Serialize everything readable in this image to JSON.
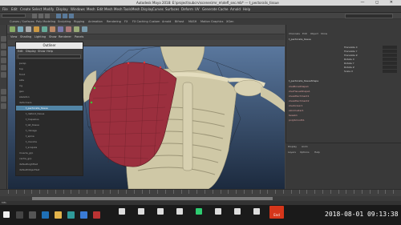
{
  "window": {
    "title": "Autodesk Maya 2018: E:\\project\\subcrv\\scenes\\mr_m\\defl_sec.mb* --- t_pectoralis_tissue",
    "controls": "— ◻ ✕"
  },
  "menubar": {
    "items": [
      "File",
      "Edit",
      "Create",
      "Select",
      "Modify",
      "Display",
      "Windows",
      "Mesh",
      "Edit Mesh",
      "Mesh Tools",
      "Mesh Display",
      "Curves",
      "Surfaces",
      "Deform",
      "UV",
      "Generate",
      "Cache",
      "Arnold",
      "Help"
    ]
  },
  "shelf": {
    "tabs": [
      "Curves / Surfaces",
      "Poly Modeling",
      "Sculpting",
      "Rigging",
      "Animation",
      "Rendering",
      "FX",
      "FX Caching",
      "Custom",
      "Arnold",
      "Bifrost",
      "MASH",
      "Motion Graphics",
      "XGen"
    ]
  },
  "viewport": {
    "menu": [
      "View",
      "Shading",
      "Lighting",
      "Show",
      "Renderer",
      "Panels"
    ]
  },
  "outliner": {
    "title": "Outliner",
    "menu": [
      "Edit",
      "Display",
      "Show",
      "Help"
    ],
    "rows": [
      {
        "label": "persp",
        "selected": false
      },
      {
        "label": "top",
        "selected": false
      },
      {
        "label": "front",
        "selected": false
      },
      {
        "label": "side",
        "selected": false
      },
      {
        "label": "rig",
        "selected": false
      },
      {
        "label": "geo",
        "selected": false
      },
      {
        "label": "skeleton",
        "selected": false
      },
      {
        "label": "deformers",
        "selected": false
      },
      {
        "label": "t_pectoralis_tissue",
        "selected": true
      },
      {
        "label": "t_deltoid_tissue",
        "selected": false
      },
      {
        "label": "t_trapezius",
        "selected": false
      },
      {
        "label": "t_lat_tissue",
        "selected": false
      },
      {
        "label": "t_ribcage",
        "selected": false
      },
      {
        "label": "t_spine",
        "selected": false
      },
      {
        "label": "t_clavicle",
        "selected": false
      },
      {
        "label": "t_scapula",
        "selected": false
      },
      {
        "label": "muscle_grp",
        "selected": false
      },
      {
        "label": "cache_grp",
        "selected": false
      },
      {
        "label": "defaultLightSet",
        "selected": false
      },
      {
        "label": "defaultObjectSet",
        "selected": false
      }
    ]
  },
  "channelbox": {
    "tabs": [
      "Channels",
      "Edit",
      "Object",
      "Show"
    ],
    "object": "t_pectoralis_tissue",
    "attributes": [
      "Translate X",
      "Translate Y",
      "Translate Z",
      "Rotate X",
      "Rotate Y",
      "Rotate Z",
      "Scale X"
    ],
    "history_label": "t_pectoralis_tissueShape",
    "inputs": [
      "zivaBoneShape1",
      "zivaTissueShape1",
      "zivaAttachment1",
      "zivaAttachment2",
      "zivaSolver1",
      "skinCluster1",
      "tweak1",
      "polySmooth1"
    ]
  },
  "layers": {
    "tabs": [
      "Display",
      "Anim"
    ],
    "menu": [
      "Layers",
      "Options",
      "Help"
    ]
  },
  "commandline": {
    "label": "MEL"
  },
  "zoom": {
    "buttons": [
      {
        "label": "Mute",
        "icon": "mic-icon"
      },
      {
        "label": "Stop Video",
        "icon": "video-icon"
      },
      {
        "label": "Manage Participants",
        "icon": "participants-icon"
      },
      {
        "label": "Polls",
        "icon": "polls-icon"
      },
      {
        "label": "Share Screen",
        "icon": "share-icon"
      },
      {
        "label": "Pause Share",
        "icon": "pause-icon"
      },
      {
        "label": "Annotate",
        "icon": "pen-icon"
      },
      {
        "label": "Remote Control",
        "icon": "remote-icon"
      }
    ],
    "end_label": "End"
  },
  "clock": {
    "text": "2018-08-01  09:13:38"
  },
  "colors": {
    "accent_selection": "#5285a6",
    "end_button": "#d6361a",
    "muscle": "#9b2f3e",
    "bone": "#d7d0b0"
  }
}
